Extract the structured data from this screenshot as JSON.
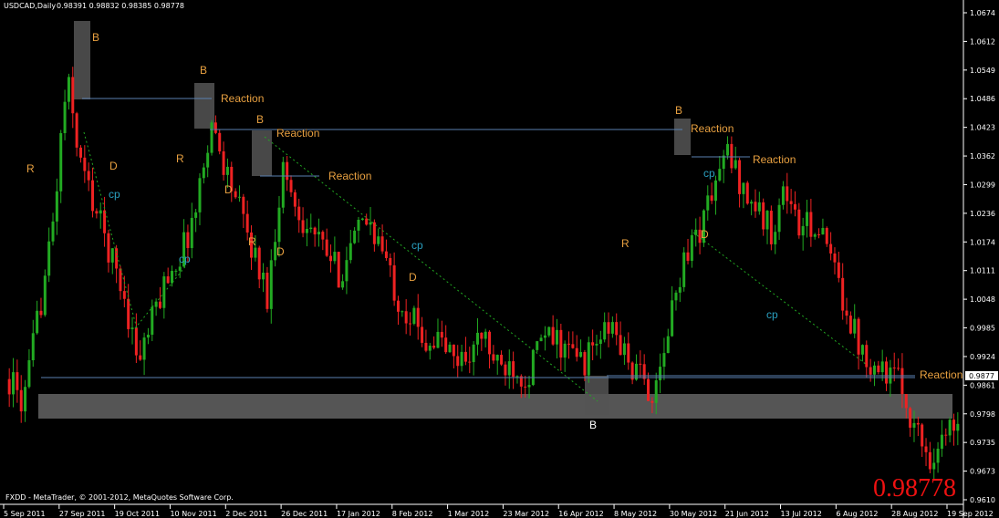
{
  "chart_data": {
    "type": "candlestick",
    "title": "USDCAD,Daily",
    "ohlc_readout": "0.98391 0.98832 0.98385 0.98778",
    "footer": "FXDD - MetaTrader, © 2001-2012, MetaQuotes Software Corp.",
    "last_price": "0.98778",
    "current_price_tag": "0.9877",
    "ylim": [
      0.96,
      1.07
    ],
    "y_ticks": [
      "1.0674",
      "1.0612",
      "1.0549",
      "1.0486",
      "1.0423",
      "1.0362",
      "1.0299",
      "1.0236",
      "1.0174",
      "1.0111",
      "1.0048",
      "0.9985",
      "0.9924",
      "0.9861",
      "0.9798",
      "0.9735",
      "0.9673",
      "0.9610"
    ],
    "x_ticks": [
      "5 Sep 2011",
      "27 Sep 2011",
      "19 Oct 2011",
      "10 Nov 2011",
      "2 Dec 2011",
      "26 Dec 2011",
      "17 Jan 2012",
      "8 Feb 2012",
      "1 Mar 2012",
      "23 Mar 2012",
      "16 Apr 2012",
      "8 May 2012",
      "30 May 2012",
      "21 Jun 2012",
      "13 Jul 2012",
      "6 Aug 2012",
      "28 Aug 2012",
      "19 Sep 2012"
    ],
    "close_path": [
      0.986,
      0.98,
      1.0,
      1.02,
      1.055,
      1.035,
      1.025,
      1.015,
      1.005,
      0.99,
      1.0,
      1.01,
      1.015,
      1.025,
      1.045,
      1.035,
      1.025,
      1.015,
      1.005,
      1.035,
      1.025,
      1.02,
      1.015,
      1.01,
      1.018,
      1.023,
      1.015,
      1.005,
      1.0,
      0.995,
      0.995,
      0.99,
      0.992,
      0.996,
      0.988,
      0.99,
      0.986,
      0.995,
      0.995,
      0.992,
      0.99,
      0.995,
      0.998,
      0.99,
      0.986,
      0.982,
      1.0,
      1.015,
      1.02,
      1.03,
      1.038,
      1.03,
      1.025,
      1.02,
      1.03,
      1.02,
      1.022,
      1.015,
      1.005,
      0.995,
      0.99,
      0.988,
      0.985,
      0.975,
      0.968,
      0.972,
      0.978
    ],
    "annotations": [
      {
        "text": "B",
        "color": "#e8a040"
      },
      {
        "text": "B",
        "color": "#e8a040"
      },
      {
        "text": "B",
        "color": "#e8a040"
      },
      {
        "text": "B",
        "color": "#e8a040"
      },
      {
        "text": "B",
        "color": "#ffffff"
      },
      {
        "text": "R",
        "color": "#e8a040"
      },
      {
        "text": "R",
        "color": "#e8a040"
      },
      {
        "text": "R",
        "color": "#e8a040"
      },
      {
        "text": "R",
        "color": "#e8a040"
      },
      {
        "text": "D",
        "color": "#e8a040"
      },
      {
        "text": "D",
        "color": "#e8a040"
      },
      {
        "text": "D",
        "color": "#e8a040"
      },
      {
        "text": "D",
        "color": "#e8a040"
      },
      {
        "text": "D",
        "color": "#e8a040"
      },
      {
        "text": "cp",
        "color": "#2aa0c0"
      },
      {
        "text": "cp",
        "color": "#2aa0c0"
      },
      {
        "text": "cp",
        "color": "#2aa0c0"
      },
      {
        "text": "cp",
        "color": "#2aa0c0"
      },
      {
        "text": "cp",
        "color": "#2aa0c0"
      },
      {
        "text": "Reaction",
        "color": "#e8a040"
      },
      {
        "text": "Reaction",
        "color": "#e8a040"
      },
      {
        "text": "Reaction",
        "color": "#e8a040"
      },
      {
        "text": "Reaction",
        "color": "#e8a040"
      },
      {
        "text": "Reaction",
        "color": "#e8a040"
      },
      {
        "text": "Reaction",
        "color": "#e8a040"
      }
    ],
    "colors": {
      "bull": "#22aa22",
      "bear": "#ee2222",
      "zone": "#555555",
      "hline": "#5a7fb0",
      "trend": "#22aa22",
      "axis": "#ffffff",
      "last_price": "#ee1111",
      "bg": "#000000"
    }
  }
}
